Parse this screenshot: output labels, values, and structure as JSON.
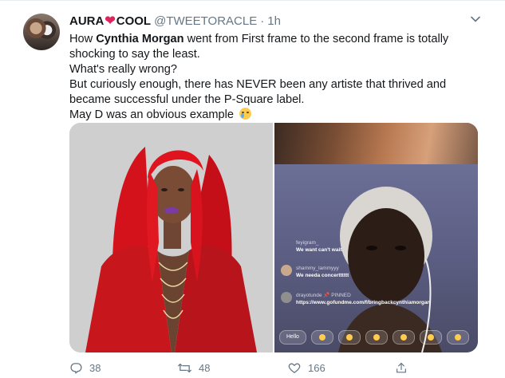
{
  "author": {
    "name_part1": "AURA",
    "heart": "❤",
    "name_part2": "COOL",
    "handle": "@TWEETORACLE",
    "separator": "·",
    "time": "1h"
  },
  "tweet": {
    "line1_pre": "How ",
    "line1_bold": "Cynthia Morgan",
    "line1_post": " went from First frame to the second frame is totally shocking to say the least.",
    "line2": "What's really wrong?",
    "line3": "But curiously enough, there has NEVER been any artiste that thrived and became successful under the P-Square label.",
    "line4": "May D was an obvious example"
  },
  "live_comments": [
    {
      "user": "feyigram_",
      "text": "We want can't wait."
    },
    {
      "user": "shammy_lammyyy",
      "text": "We needa concertttttt"
    },
    {
      "user": "drayotunde 📌 PINNED",
      "text": "https://www.gofundme.com/f/bringbackcynthiamorgan"
    }
  ],
  "live_bar": {
    "hello": "Hello"
  },
  "actions": {
    "replies": "38",
    "retweets": "48",
    "likes": "166"
  },
  "colors": {
    "accent_heart": "#e0245e",
    "muted": "#657786",
    "text": "#14171a"
  }
}
